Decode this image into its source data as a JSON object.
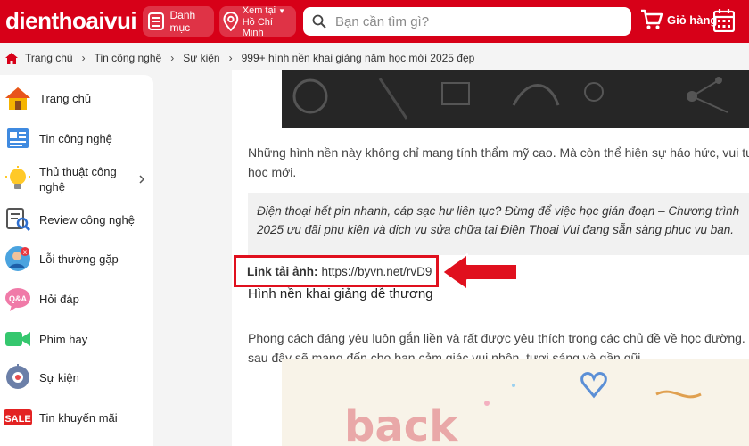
{
  "header": {
    "logo": "dienthoaivui",
    "menu_label": "Danh mục",
    "location_line1": "Xem tại",
    "location_line2": "Hồ Chí Minh",
    "search_placeholder": "Bạn cần tìm gì?",
    "cart_label": "Giỏ hàng",
    "brand_color": "#d70018"
  },
  "breadcrumb": [
    "Trang chủ",
    "Tin công nghệ",
    "Sự kiện",
    "999+ hình nền khai giảng năm học mới 2025 đẹp"
  ],
  "sidebar": {
    "items": [
      {
        "label": "Trang chủ",
        "icon": "house-icon"
      },
      {
        "label": "Tin công nghệ",
        "icon": "news-icon"
      },
      {
        "label": "Thủ thuật công nghệ",
        "icon": "lightbulb-icon",
        "has_submenu": true
      },
      {
        "label": "Review công nghệ",
        "icon": "review-icon"
      },
      {
        "label": "Lỗi thường gặp",
        "icon": "error-user-icon"
      },
      {
        "label": "Hỏi đáp",
        "icon": "qa-icon"
      },
      {
        "label": "Phim hay",
        "icon": "video-camera-icon"
      },
      {
        "label": "Sự kiện",
        "icon": "event-icon"
      },
      {
        "label": "Tin khuyến mãi",
        "icon": "sale-icon"
      }
    ]
  },
  "article": {
    "para1_line1": "Những hình nền này không chỉ mang tính thẩm mỹ cao. Mà còn thể hiện sự háo hức, vui tươi c",
    "para1_line2": "học mới.",
    "quote_line1": "Điện thoại hết pin nhanh, cáp sạc hư liên tục? Đừng để việc học gián đoạn – Chương trình",
    "quote_line2": "2025 ưu đãi phụ kiện và dịch vụ sửa chữa tại Điện Thoại Vui đang sẵn sàng phục vụ bạn.",
    "link_label": "Link tải ảnh:",
    "link_url": "https://byvn.net/rvD9",
    "heading": "Hình nền khai giảng dễ thương",
    "para2_line1": "Phong cách đáng yêu luôn gắn liền và rất được yêu thích trong các chủ đề về học đường. Bộ",
    "para2_line2": "sau đây sẽ mang đến cho bạn cảm giác vui nhộn, tươi sáng và gần gũi."
  }
}
